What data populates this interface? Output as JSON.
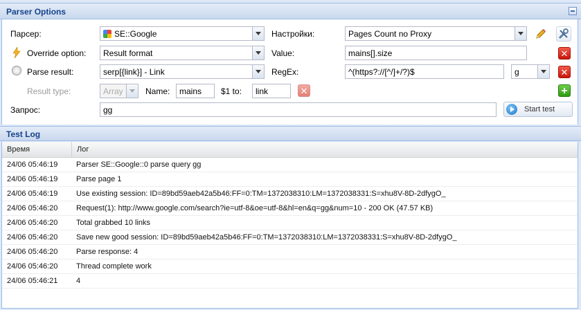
{
  "options_panel": {
    "title": "Parser Options",
    "parser_label": "Парсер:",
    "parser_value": "SE::Google",
    "settings_label": "Настройки:",
    "settings_value": "Pages Count no Proxy",
    "override_label": "Override option:",
    "override_value": "Result format",
    "value_label": "Value:",
    "value_value": "mains[].size",
    "parse_result_label": "Parse result:",
    "parse_result_value": "serp[{link}] - Link",
    "regex_label": "RegEx:",
    "regex_value": "^(https?://[^/]+/?)$",
    "regex_flag_value": "g",
    "result_type_label": "Result type:",
    "result_type_value": "Array",
    "name_label": "Name:",
    "name_value": "mains",
    "s1_label": "$1 to:",
    "s1_value": "link",
    "query_label": "Запрос:",
    "query_value": "gg",
    "start_button": "Start test"
  },
  "log_panel": {
    "title": "Test Log",
    "columns": {
      "time": "Время",
      "log": "Лог"
    },
    "rows": [
      {
        "time": "24/06 05:46:19",
        "log": "Parser SE::Google::0 parse query gg"
      },
      {
        "time": "24/06 05:46:19",
        "log": "Parse page 1"
      },
      {
        "time": "24/06 05:46:19",
        "log": "Use existing session: ID=89bd59aeb42a5b46:FF=0:TM=1372038310:LM=1372038331:S=xhu8V-8D-2dfygO_"
      },
      {
        "time": "24/06 05:46:20",
        "log": "Request(1): http://www.google.com/search?ie=utf-8&oe=utf-8&hl=en&q=gg&num=10 - 200 OK (47.57 KB)"
      },
      {
        "time": "24/06 05:46:20",
        "log": "Total grabbed 10 links"
      },
      {
        "time": "24/06 05:46:20",
        "log": "Save new good session: ID=89bd59aeb42a5b46:FF=0:TM=1372038310:LM=1372038331:S=xhu8V-8D-2dfygO_"
      },
      {
        "time": "24/06 05:46:20",
        "log": "Parse response: 4"
      },
      {
        "time": "24/06 05:46:20",
        "log": "Thread complete work"
      },
      {
        "time": "24/06 05:46:21",
        "log": "4"
      }
    ]
  },
  "icons": {
    "edit": "pencil-icon",
    "tools": "tools-icon",
    "delete": "delete-icon",
    "add": "add-icon",
    "override": "lightning-icon",
    "parse_result": "parse-result-icon",
    "start": "play-icon"
  },
  "colors": {
    "panel_title": "#15428b",
    "panel_border": "#99bbe8",
    "delete_red": "#d2281a",
    "add_green": "#3fa81d"
  }
}
